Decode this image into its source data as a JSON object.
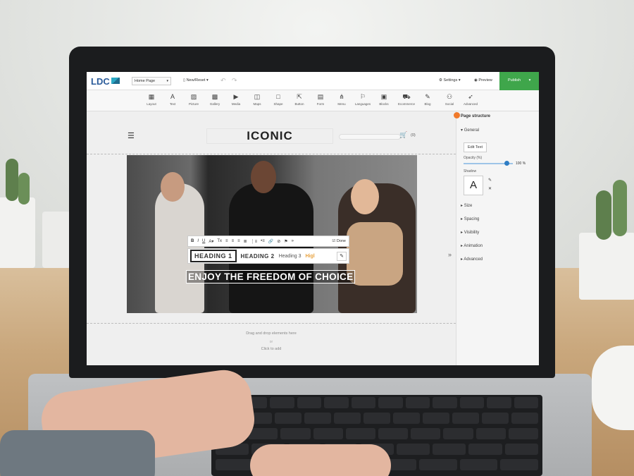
{
  "app": {
    "logo_text": "LDC",
    "page_select": "Home Page",
    "new_reset": "New/Reset",
    "settings": "Settings",
    "preview": "Preview",
    "publish": "Publish"
  },
  "toolbar": [
    {
      "label": "Layout",
      "icon": "layout-icon"
    },
    {
      "label": "Text",
      "icon": "text-icon"
    },
    {
      "label": "Picture",
      "icon": "picture-icon"
    },
    {
      "label": "Gallery",
      "icon": "gallery-icon"
    },
    {
      "label": "Media",
      "icon": "media-icon"
    },
    {
      "label": "Maps",
      "icon": "maps-icon"
    },
    {
      "label": "Shape",
      "icon": "shape-icon"
    },
    {
      "label": "Button",
      "icon": "button-icon"
    },
    {
      "label": "Form",
      "icon": "form-icon"
    },
    {
      "label": "Menu",
      "icon": "menu-icon"
    },
    {
      "label": "Languages",
      "icon": "languages-icon"
    },
    {
      "label": "Blocks",
      "icon": "blocks-icon"
    },
    {
      "label": "Ecommerce",
      "icon": "ecommerce-icon"
    },
    {
      "label": "Blog",
      "icon": "blog-icon"
    },
    {
      "label": "Social",
      "icon": "social-icon"
    },
    {
      "label": "Advanced",
      "icon": "advanced-icon"
    }
  ],
  "site": {
    "brand": "ICONIC",
    "cart_count": "(0)"
  },
  "editor": {
    "done": "Done",
    "heading1": "HEADING 1",
    "heading2": "HEADING 2",
    "heading3": "Heading 3",
    "highlight": "Higl",
    "hero_text": "ENJOY THE FREEDOM OF CHOICE",
    "drag_hint": "Drag and drop elements here",
    "or": "or",
    "click_add": "Click to add"
  },
  "panel": {
    "title": "Page structure",
    "general": "General",
    "edit_text": "Edit Text",
    "opacity_label": "Opacity (%)",
    "opacity_value": "100",
    "opacity_unit": "%",
    "shadow_label": "Shadow",
    "shadow_preview": "A",
    "sections": [
      "Size",
      "Spacing",
      "Visibility",
      "Animation",
      "Advanced"
    ]
  },
  "colors": {
    "publish": "#3fa64b",
    "accent_orange": "#f07a2b",
    "slider": "#2e7dc4"
  }
}
